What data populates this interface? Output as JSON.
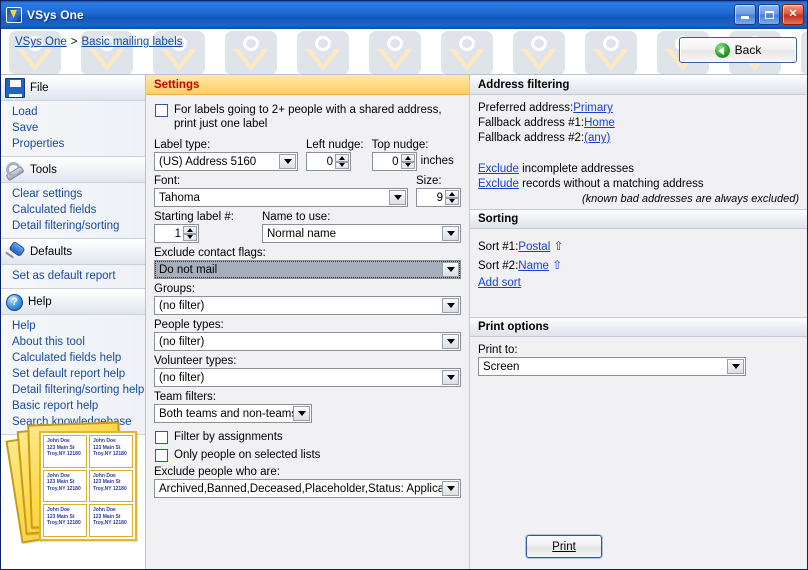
{
  "window": {
    "title": "VSys One",
    "icon": "vsys-logo-icon",
    "minimize_label": "Minimize",
    "maximize_label": "Maximize",
    "close_label": "Close"
  },
  "breadcrumb": {
    "root": "VSys One",
    "separator": ">",
    "current": "Basic mailing labels"
  },
  "back_button": {
    "label": "Back",
    "icon": "back-arrow-icon"
  },
  "sidebar": {
    "groups": [
      {
        "title": "File",
        "icon": "floppy-disk-icon",
        "items": [
          "Load",
          "Save",
          "Properties"
        ]
      },
      {
        "title": "Tools",
        "icon": "wrench-icon",
        "items": [
          "Clear settings",
          "Calculated fields",
          "Detail filtering/sorting"
        ]
      },
      {
        "title": "Defaults",
        "icon": "pushpin-icon",
        "items": [
          "Set as default report"
        ]
      },
      {
        "title": "Help",
        "icon": "help-circle-icon",
        "items": [
          "Help",
          "About this tool",
          "Calculated fields help",
          "Set default report help",
          "Detail filtering/sorting help",
          "Basic report help",
          "Search knowledgebase"
        ]
      }
    ],
    "illustration": {
      "name": "mailing-labels-illustration",
      "label_lines": [
        "John Doe",
        "123 Main St",
        "Troy,NY 12180"
      ],
      "label_count": 6
    }
  },
  "settings": {
    "title": "Settings",
    "title_color": "#cc0000",
    "shared_address_checkbox": {
      "label": "For labels going to 2+ people with a shared address, print just one label",
      "checked": false
    },
    "label_type": {
      "label": "Label type:",
      "value": "(US) Address 5160"
    },
    "left_nudge": {
      "label": "Left nudge:",
      "value": "0"
    },
    "top_nudge": {
      "label": "Top nudge:",
      "value": "0"
    },
    "units": "inches",
    "font": {
      "label": "Font:",
      "value": "Tahoma"
    },
    "size": {
      "label": "Size:",
      "value": "9"
    },
    "starting_label": {
      "label": "Starting label #:",
      "value": "1"
    },
    "name_to_use": {
      "label": "Name to use:",
      "value": "Normal name"
    },
    "exclude_contact_flags": {
      "label": "Exclude contact flags:",
      "value": "Do not mail",
      "selected": true
    },
    "groups": {
      "label": "Groups:",
      "value": "(no filter)"
    },
    "people_types": {
      "label": "People types:",
      "value": "(no filter)"
    },
    "volunteer_types": {
      "label": "Volunteer types:",
      "value": "(no filter)"
    },
    "team_filters": {
      "label": "Team filters:",
      "value": "Both teams and non-teams"
    },
    "filter_by_assignments": {
      "label": "Filter by assignments",
      "checked": false
    },
    "only_selected_lists": {
      "label": "Only people on selected lists",
      "checked": false
    },
    "exclude_people": {
      "label": "Exclude people who are:",
      "value": "Archived,Banned,Deceased,Placeholder,Status: Applicant"
    }
  },
  "address_filtering": {
    "title": "Address filtering",
    "preferred_label": "Preferred address:",
    "preferred_value": "Primary",
    "fallback1_label": "Fallback address #1:",
    "fallback1_value": "Home",
    "fallback2_label": "Fallback address #2:",
    "fallback2_value": "(any)",
    "exclude_incomplete_link": "Exclude",
    "exclude_incomplete_rest": " incomplete addresses",
    "exclude_nomatch_link": "Exclude",
    "exclude_nomatch_rest": " records without a matching address",
    "note": "(known bad addresses are always excluded)"
  },
  "sorting": {
    "title": "Sorting",
    "sort1_label": "Sort #1:",
    "sort1_value": "Postal",
    "sort1_direction": "⇧",
    "sort2_label": "Sort #2:",
    "sort2_value": "Name",
    "sort2_direction": "⇧",
    "add_sort": "Add sort"
  },
  "print_options": {
    "title": "Print options",
    "print_to_label": "Print to:",
    "print_to_value": "Screen"
  },
  "print_button": {
    "label": "Print"
  }
}
